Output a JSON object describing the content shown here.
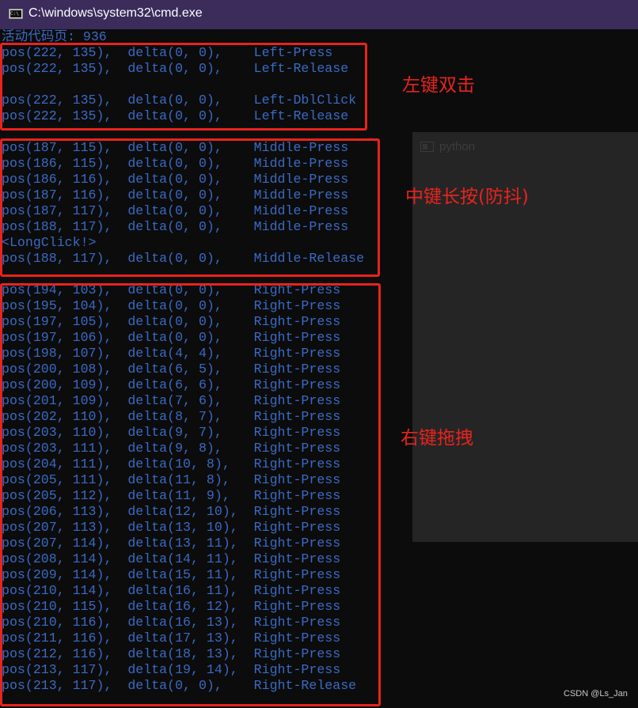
{
  "window": {
    "title": "C:\\windows\\system32\\cmd.exe",
    "icon": "cmd-icon"
  },
  "background_window": {
    "title": "python",
    "icon": "window-icon"
  },
  "console_lines": [
    "活动代码页: 936",
    "pos(222, 135),  delta(0, 0),    Left-Press",
    "pos(222, 135),  delta(0, 0),    Left-Release",
    "",
    "pos(222, 135),  delta(0, 0),    Left-DblClick",
    "pos(222, 135),  delta(0, 0),    Left-Release",
    "",
    "pos(187, 115),  delta(0, 0),    Middle-Press",
    "pos(186, 115),  delta(0, 0),    Middle-Press",
    "pos(186, 116),  delta(0, 0),    Middle-Press",
    "pos(187, 116),  delta(0, 0),    Middle-Press",
    "pos(187, 117),  delta(0, 0),    Middle-Press",
    "pos(188, 117),  delta(0, 0),    Middle-Press",
    "<LongClick!>",
    "pos(188, 117),  delta(0, 0),    Middle-Release",
    "",
    "pos(194, 103),  delta(0, 0),    Right-Press",
    "pos(195, 104),  delta(0, 0),    Right-Press",
    "pos(197, 105),  delta(0, 0),    Right-Press",
    "pos(197, 106),  delta(0, 0),    Right-Press",
    "pos(198, 107),  delta(4, 4),    Right-Press",
    "pos(200, 108),  delta(6, 5),    Right-Press",
    "pos(200, 109),  delta(6, 6),    Right-Press",
    "pos(201, 109),  delta(7, 6),    Right-Press",
    "pos(202, 110),  delta(8, 7),    Right-Press",
    "pos(203, 110),  delta(9, 7),    Right-Press",
    "pos(203, 111),  delta(9, 8),    Right-Press",
    "pos(204, 111),  delta(10, 8),   Right-Press",
    "pos(205, 111),  delta(11, 8),   Right-Press",
    "pos(205, 112),  delta(11, 9),   Right-Press",
    "pos(206, 113),  delta(12, 10),  Right-Press",
    "pos(207, 113),  delta(13, 10),  Right-Press",
    "pos(207, 114),  delta(13, 11),  Right-Press",
    "pos(208, 114),  delta(14, 11),  Right-Press",
    "pos(209, 114),  delta(15, 11),  Right-Press",
    "pos(210, 114),  delta(16, 11),  Right-Press",
    "pos(210, 115),  delta(16, 12),  Right-Press",
    "pos(210, 116),  delta(16, 13),  Right-Press",
    "pos(211, 116),  delta(17, 13),  Right-Press",
    "pos(212, 116),  delta(18, 13),  Right-Press",
    "pos(213, 117),  delta(19, 14),  Right-Press",
    "pos(213, 117),  delta(0, 0),    Right-Release"
  ],
  "annotations": {
    "left": "左键双击",
    "middle": "中键长按(防抖)",
    "right": "右键拖拽"
  },
  "watermark": "CSDN @Ls_Jan",
  "colors": {
    "text": "#3a6ac4",
    "annotation": "#e8231d",
    "titlebar": "#3b2c5c",
    "background": "#0c0c0c"
  }
}
